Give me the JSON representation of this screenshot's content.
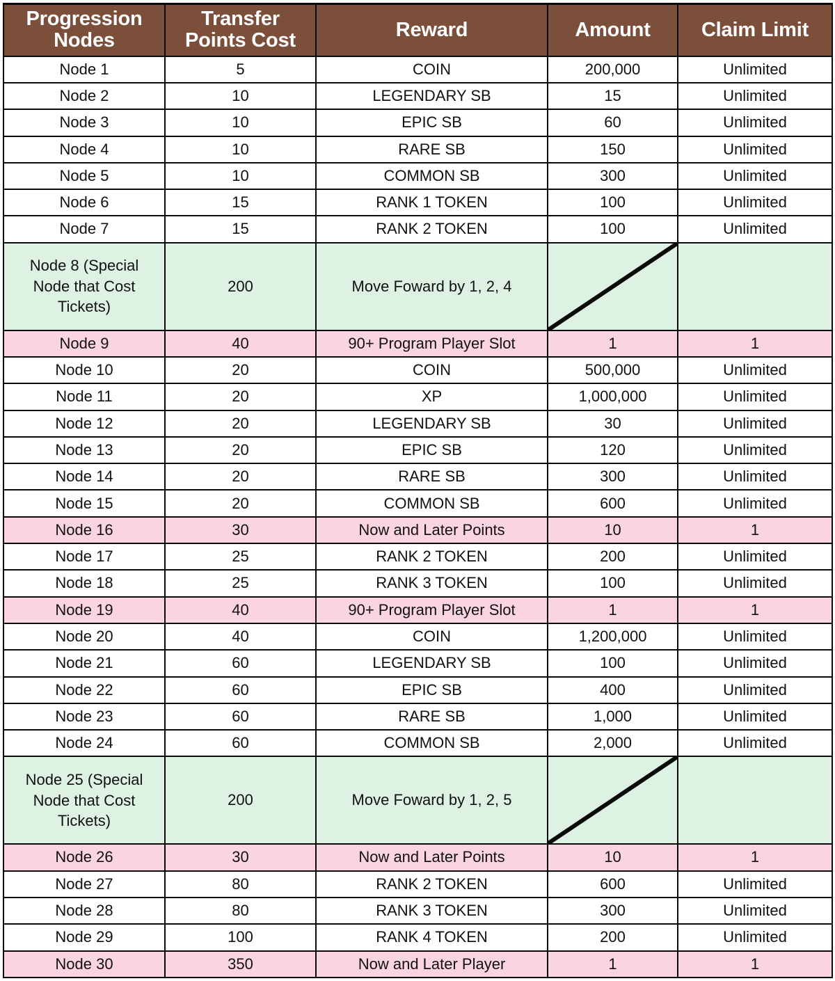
{
  "table": {
    "columns": [
      {
        "key": "node",
        "label": "Progression Nodes"
      },
      {
        "key": "cost",
        "label": "Transfer Points Cost"
      },
      {
        "key": "reward",
        "label": "Reward"
      },
      {
        "key": "amount",
        "label": "Amount"
      },
      {
        "key": "claim",
        "label": "Claim Limit"
      }
    ],
    "colors": {
      "header_background": "#7B4F3A",
      "header_text": "#FFFFFF",
      "special_row_background": "#DEF2E4",
      "highlight_row_background": "#FBD4E4",
      "default_row_background": "#FFFFFF",
      "border": "#0A0A0A"
    },
    "rows": [
      {
        "node": "Node 1",
        "cost": "5",
        "reward": "COIN",
        "amount": "200,000",
        "claim": "Unlimited",
        "style": "default"
      },
      {
        "node": "Node 2",
        "cost": "10",
        "reward": "LEGENDARY SB",
        "amount": "15",
        "claim": "Unlimited",
        "style": "default"
      },
      {
        "node": "Node 3",
        "cost": "10",
        "reward": "EPIC SB",
        "amount": "60",
        "claim": "Unlimited",
        "style": "default"
      },
      {
        "node": "Node 4",
        "cost": "10",
        "reward": "RARE SB",
        "amount": "150",
        "claim": "Unlimited",
        "style": "default"
      },
      {
        "node": "Node 5",
        "cost": "10",
        "reward": "COMMON SB",
        "amount": "300",
        "claim": "Unlimited",
        "style": "default"
      },
      {
        "node": "Node 6",
        "cost": "15",
        "reward": "RANK 1 TOKEN",
        "amount": "100",
        "claim": "Unlimited",
        "style": "default"
      },
      {
        "node": "Node 7",
        "cost": "15",
        "reward": "RANK 2 TOKEN",
        "amount": "100",
        "claim": "Unlimited",
        "style": "default"
      },
      {
        "node": "Node 8 (Special Node that Cost Tickets)",
        "cost": "200",
        "reward": "Move Foward by 1, 2, 4",
        "amount": "",
        "claim": "",
        "style": "special",
        "tall": true,
        "slash_amount": true
      },
      {
        "node": "Node 9",
        "cost": "40",
        "reward": "90+ Program Player Slot",
        "amount": "1",
        "claim": "1",
        "style": "highlight"
      },
      {
        "node": "Node 10",
        "cost": "20",
        "reward": "COIN",
        "amount": "500,000",
        "claim": "Unlimited",
        "style": "default"
      },
      {
        "node": "Node 11",
        "cost": "20",
        "reward": "XP",
        "amount": "1,000,000",
        "claim": "Unlimited",
        "style": "default"
      },
      {
        "node": "Node 12",
        "cost": "20",
        "reward": "LEGENDARY SB",
        "amount": "30",
        "claim": "Unlimited",
        "style": "default"
      },
      {
        "node": "Node 13",
        "cost": "20",
        "reward": "EPIC SB",
        "amount": "120",
        "claim": "Unlimited",
        "style": "default"
      },
      {
        "node": "Node 14",
        "cost": "20",
        "reward": "RARE SB",
        "amount": "300",
        "claim": "Unlimited",
        "style": "default"
      },
      {
        "node": "Node 15",
        "cost": "20",
        "reward": "COMMON SB",
        "amount": "600",
        "claim": "Unlimited",
        "style": "default"
      },
      {
        "node": "Node 16",
        "cost": "30",
        "reward": "Now and Later Points",
        "amount": "10",
        "claim": "1",
        "style": "highlight"
      },
      {
        "node": "Node 17",
        "cost": "25",
        "reward": "RANK 2 TOKEN",
        "amount": "200",
        "claim": "Unlimited",
        "style": "default"
      },
      {
        "node": "Node 18",
        "cost": "25",
        "reward": "RANK 3 TOKEN",
        "amount": "100",
        "claim": "Unlimited",
        "style": "default"
      },
      {
        "node": "Node 19",
        "cost": "40",
        "reward": "90+ Program Player Slot",
        "amount": "1",
        "claim": "1",
        "style": "highlight"
      },
      {
        "node": "Node 20",
        "cost": "40",
        "reward": "COIN",
        "amount": "1,200,000",
        "claim": "Unlimited",
        "style": "default"
      },
      {
        "node": "Node 21",
        "cost": "60",
        "reward": "LEGENDARY SB",
        "amount": "100",
        "claim": "Unlimited",
        "style": "default"
      },
      {
        "node": "Node 22",
        "cost": "60",
        "reward": "EPIC SB",
        "amount": "400",
        "claim": "Unlimited",
        "style": "default"
      },
      {
        "node": "Node 23",
        "cost": "60",
        "reward": "RARE SB",
        "amount": "1,000",
        "claim": "Unlimited",
        "style": "default"
      },
      {
        "node": "Node 24",
        "cost": "60",
        "reward": "COMMON SB",
        "amount": "2,000",
        "claim": "Unlimited",
        "style": "default"
      },
      {
        "node": "Node 25 (Special Node that Cost Tickets)",
        "cost": "200",
        "reward": "Move Foward by 1, 2, 5",
        "amount": "",
        "claim": "",
        "style": "special",
        "tall": true,
        "slash_amount": true
      },
      {
        "node": "Node 26",
        "cost": "30",
        "reward": "Now and Later Points",
        "amount": "10",
        "claim": "1",
        "style": "highlight"
      },
      {
        "node": "Node 27",
        "cost": "80",
        "reward": "RANK 2 TOKEN",
        "amount": "600",
        "claim": "Unlimited",
        "style": "default"
      },
      {
        "node": "Node 28",
        "cost": "80",
        "reward": "RANK 3 TOKEN",
        "amount": "300",
        "claim": "Unlimited",
        "style": "default"
      },
      {
        "node": "Node 29",
        "cost": "100",
        "reward": "RANK 4 TOKEN",
        "amount": "200",
        "claim": "Unlimited",
        "style": "default"
      },
      {
        "node": "Node 30",
        "cost": "350",
        "reward": "Now and Later Player",
        "amount": "1",
        "claim": "1",
        "style": "highlight"
      }
    ]
  }
}
